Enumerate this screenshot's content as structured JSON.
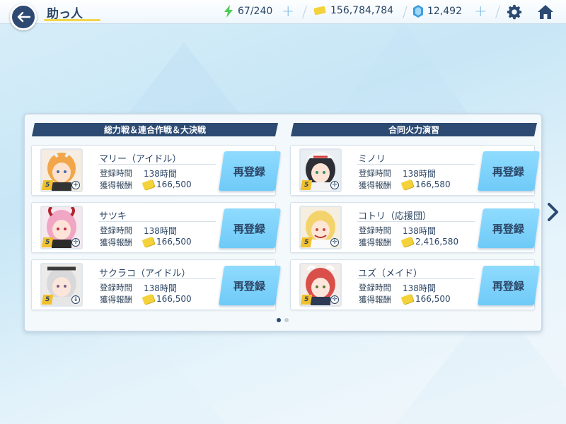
{
  "header": {
    "title": "助っ人",
    "ap": "67/240",
    "credits": "156,784,784",
    "pyroxene": "12,492"
  },
  "sections": [
    {
      "header": "総力戦＆連合作戦＆大決戦",
      "cards": [
        {
          "name": "マリー（アイドル）",
          "time_label": "登録時間",
          "time_value": "138時間",
          "reward_label": "獲得報酬",
          "reward_value": "166,500",
          "button": "再登録",
          "stars": "5"
        },
        {
          "name": "サツキ",
          "time_label": "登録時間",
          "time_value": "138時間",
          "reward_label": "獲得報酬",
          "reward_value": "166,500",
          "button": "再登録",
          "stars": "5"
        },
        {
          "name": "サクラコ（アイドル）",
          "time_label": "登録時間",
          "time_value": "138時間",
          "reward_label": "獲得報酬",
          "reward_value": "166,500",
          "button": "再登録",
          "stars": "5"
        }
      ]
    },
    {
      "header": "合同火力演習",
      "cards": [
        {
          "name": "ミノリ",
          "time_label": "登録時間",
          "time_value": "138時間",
          "reward_label": "獲得報酬",
          "reward_value": "166,580",
          "button": "再登録",
          "stars": "5"
        },
        {
          "name": "コトリ（応援団）",
          "time_label": "登録時間",
          "time_value": "138時間",
          "reward_label": "獲得報酬",
          "reward_value": "2,416,580",
          "button": "再登録",
          "stars": "5"
        },
        {
          "name": "ユズ（メイド）",
          "time_label": "登録時間",
          "time_value": "138時間",
          "reward_label": "獲得報酬",
          "reward_value": "166,500",
          "button": "再登録",
          "stars": "5"
        }
      ]
    }
  ],
  "pagination": {
    "current": 1,
    "total": 2
  },
  "colors": {
    "accent": "#6fcaf7",
    "navy": "#2c4a72",
    "gold": "#f4d23a"
  }
}
